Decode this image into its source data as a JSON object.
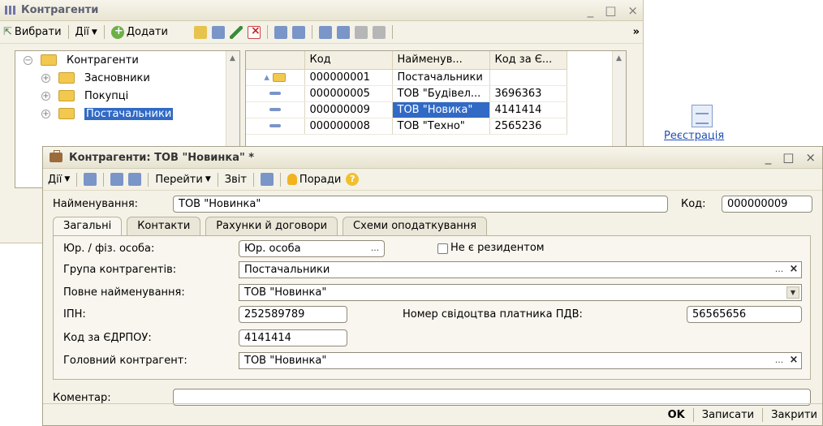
{
  "list_window": {
    "title": "Контрагенти",
    "toolbar": {
      "select": "Вибрати",
      "actions": "Дії",
      "add": "Додати",
      "more": "»"
    },
    "tree": {
      "root": "Контрагенти",
      "items": [
        "Засновники",
        "Покупці",
        "Постачальники"
      ],
      "selected": "Постачальники"
    },
    "grid": {
      "columns": [
        "Код",
        "Найменув...",
        "Код за Є..."
      ],
      "rows": [
        {
          "code": "000000001",
          "name": "Постачальники",
          "edrpou": "",
          "kind": "folder"
        },
        {
          "code": "000000005",
          "name": "ТОВ \"Будівел...",
          "edrpou": "3696363",
          "kind": "item"
        },
        {
          "code": "000000009",
          "name": "ТОВ \"Новика\"",
          "edrpou": "4141414",
          "kind": "item"
        },
        {
          "code": "000000008",
          "name": "ТОВ \"Техно\"",
          "edrpou": "2565236",
          "kind": "item"
        }
      ]
    }
  },
  "side_link": "Реєстрація",
  "form_window": {
    "title": "Контрагенти: ТОВ \"Новинка\" *",
    "toolbar": {
      "actions": "Дії",
      "goto": "Перейти",
      "report": "Звіт",
      "tips": "Поради"
    },
    "name_label": "Найменування:",
    "name_value": "ТОВ \"Новинка\"",
    "code_label": "Код:",
    "code_value": "000000009",
    "tabs": [
      "Загальні",
      "Контакти",
      "Рахунки й договори",
      "Схеми оподаткування"
    ],
    "active_tab": "Загальні",
    "fields": {
      "entity_type_label": "Юр. / фіз. особа:",
      "entity_type_value": "Юр. особа",
      "nonresident_label": "Не є резидентом",
      "group_label": "Група контрагентів:",
      "group_value": "Постачальники",
      "full_name_label": "Повне найменування:",
      "full_name_value": "ТОВ \"Новинка\"",
      "ipn_label": "ІПН:",
      "ipn_value": "252589789",
      "vat_label": "Номер свідоцтва платника ПДВ:",
      "vat_value": "56565656",
      "edrpou_label": "Код за ЄДРПОУ:",
      "edrpou_value": "4141414",
      "head_label": "Головний контрагент:",
      "head_value": "ТОВ \"Новинка\""
    },
    "comment_label": "Коментар:",
    "comment_value": "",
    "buttons": {
      "ok": "OK",
      "save": "Записати",
      "close": "Закрити"
    }
  },
  "colors": {
    "selection": "#316ac5",
    "window_bg": "#f4f1e6",
    "link": "#1f4fb0"
  }
}
